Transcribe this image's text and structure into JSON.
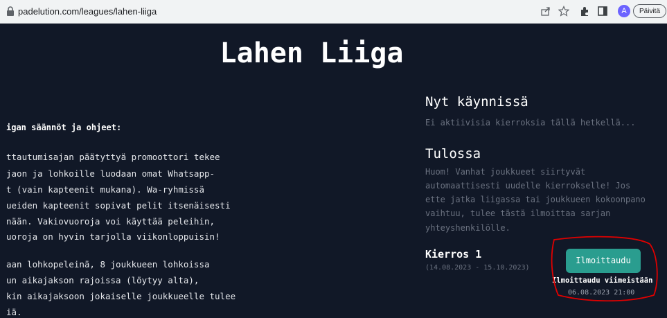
{
  "browser": {
    "url": "padelution.com/leagues/lahen-liiga",
    "avatar_letter": "A",
    "update_label": "Päivitä"
  },
  "page": {
    "title": "Lahen Liiga",
    "rules_heading": "igan säännöt ja ohjeet:",
    "rules_lines": [
      "ttautumisajan päätyttyä promoottori tekee",
      "jaon ja lohkoille luodaan omat Whatsapp-",
      "t (vain kapteenit mukana). Wa-ryhmissä",
      "ueiden kapteenit sopivat pelit itsenäisesti",
      "nään. Vakiovuoroja voi käyttää peleihin,",
      "uoroja on hyvin tarjolla viikonloppuisin!",
      "aan lohkopeleinä, 8 joukkueen lohkoissa",
      "un aikajakson rajoissa (löytyy alta),",
      "kin aikajaksoon jokaiselle joukkueelle tulee",
      "iä."
    ],
    "ongoing": {
      "heading": "Nyt käynnissä",
      "empty_text": "Ei aktiivisia kierroksia tällä hetkellä..."
    },
    "upcoming": {
      "heading": "Tulossa",
      "notice_lines": [
        "Huom! Vanhat joukkueet siirtyvät",
        "automaattisesti uudelle kierrokselle! Jos",
        "ette jatka liigassa tai joukkueen kokoonpano",
        "vaihtuu, tulee tästä ilmoittaa sarjan",
        "yhteyshenkilölle."
      ],
      "round": {
        "name": "Kierros 1",
        "dates": "(14.08.2023 - 15.10.2023)",
        "signup_button": "Ilmoittaudu",
        "deadline_label": "Ilmoittaudu viimeistään",
        "deadline_value": "06.08.2023 21:00"
      }
    }
  },
  "colors": {
    "background": "#111827",
    "button": "#2a9d8f",
    "annotation": "#e00000"
  }
}
